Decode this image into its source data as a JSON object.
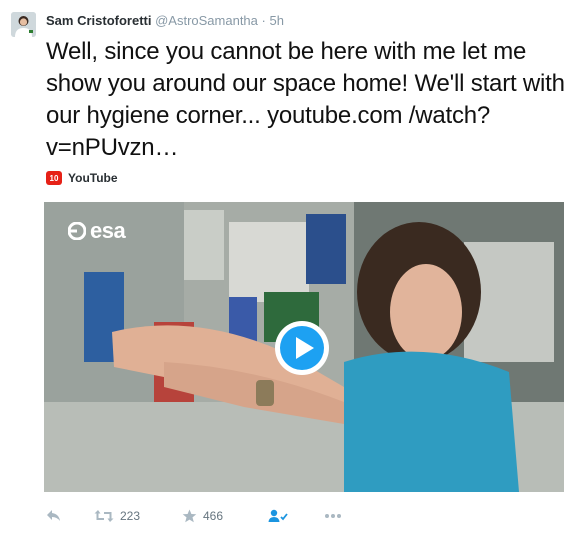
{
  "tweet": {
    "fullname": "Sam Cristoforetti",
    "username": "@AstroSamantha",
    "separator": "·",
    "time": "5h",
    "text": "Well, since you cannot be here with me let me show you around our space home! We'll start with our hygiene corner... youtube.com /watch?v=nPUvzn…"
  },
  "source": {
    "label": "YouTube",
    "icon": "youtube-logo-icon"
  },
  "video": {
    "watermark": "esa",
    "play_icon": "play-icon"
  },
  "actions": {
    "reply_icon": "reply-icon",
    "retweet_icon": "retweet-icon",
    "retweet_count": "223",
    "favorite_icon": "star-icon",
    "favorite_count": "466",
    "follow_icon": "follow-user-icon",
    "more_icon": "more-dots-icon"
  },
  "colors": {
    "link_blue": "#1da1f2",
    "muted_gray": "#8899a6",
    "youtube_red": "#e62117"
  }
}
